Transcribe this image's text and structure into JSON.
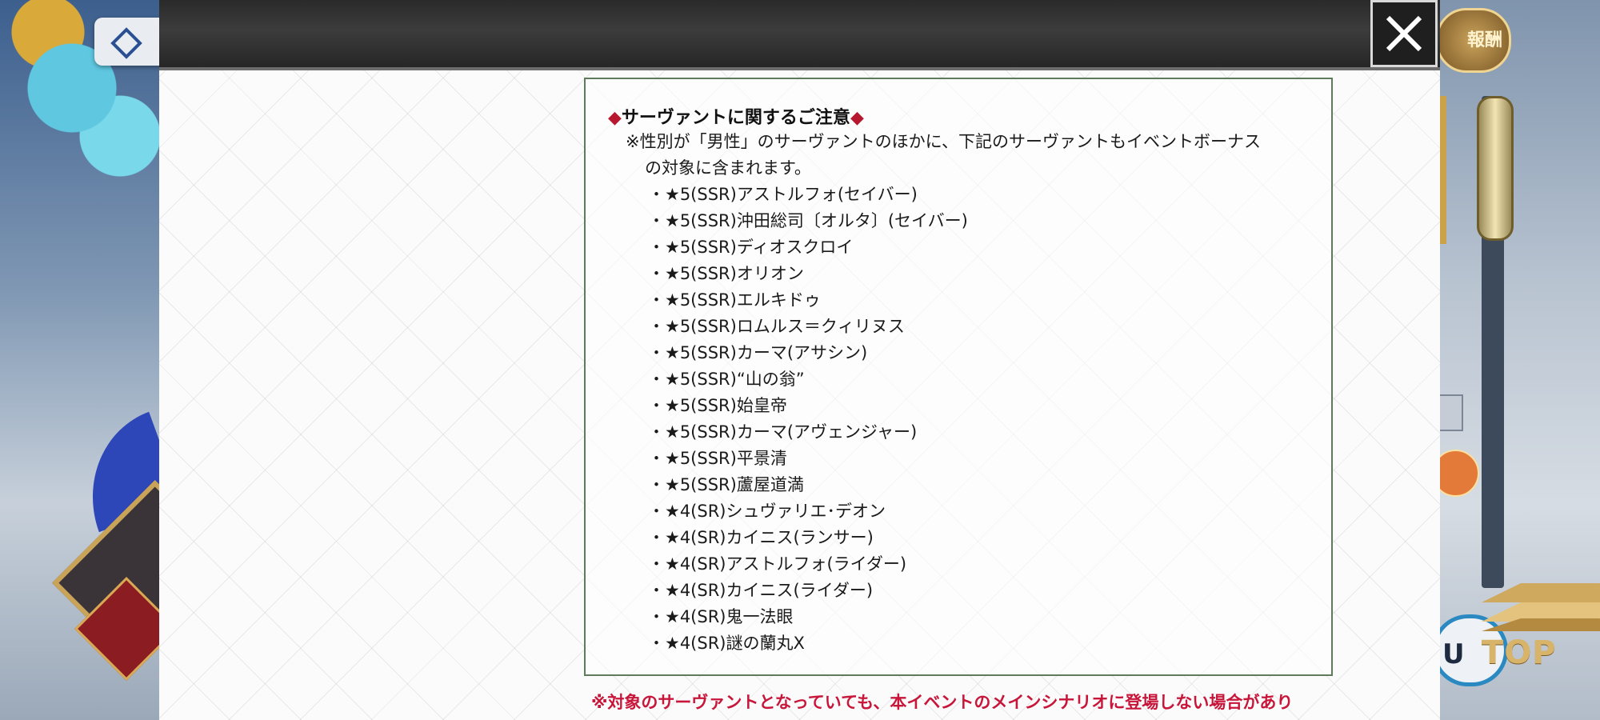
{
  "background": {
    "reward_button_label": "報酬",
    "menu_button_label": "U"
  },
  "dialog": {
    "close_icon": "close-icon",
    "notice": {
      "title_prefix": "◆",
      "title": "サーヴァントに関するご注意",
      "title_suffix": "◆",
      "body_line1": "※性別が「男性」のサーヴァントのほかに、下記のサーヴァントもイベントボーナス",
      "body_line2": "の対象に含まれます。",
      "servants": [
        "★5(SSR)アストルフォ(セイバー)",
        "★5(SSR)沖田総司〔オルタ〕(セイバー)",
        "★5(SSR)ディオスクロイ",
        "★5(SSR)オリオン",
        "★5(SSR)エルキドゥ",
        "★5(SSR)ロムルス＝クィリヌス",
        "★5(SSR)カーマ(アサシン)",
        "★5(SSR)“山の翁”",
        "★5(SSR)始皇帝",
        "★5(SSR)カーマ(アヴェンジャー)",
        "★5(SSR)平景清",
        "★5(SSR)蘆屋道満",
        "★4(SR)シュヴァリエ･デオン",
        "★4(SR)カイニス(ランサー)",
        "★4(SR)アストルフォ(ライダー)",
        "★4(SR)カイニス(ライダー)",
        "★4(SR)鬼一法眼",
        "★4(SR)謎の蘭丸X"
      ]
    },
    "warning": "※対象のサーヴァントとなっていても、本イベントのメインシナリオに登場しない場合があり",
    "top_button_label": "TOP",
    "colors": {
      "accent_red": "#b8182f",
      "warning_red": "#c8163a",
      "box_border": "#5e7c5b"
    }
  }
}
